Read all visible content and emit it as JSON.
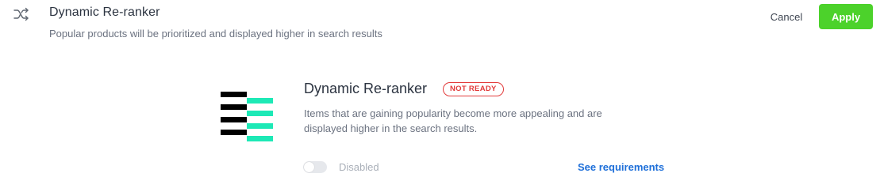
{
  "header": {
    "icon": "shuffle-icon",
    "title": "Dynamic Re-ranker",
    "subtitle": "Popular products will be prioritized and displayed higher in search results"
  },
  "actions": {
    "cancel_label": "Cancel",
    "apply_label": "Apply",
    "apply_color": "#4cd22b"
  },
  "card": {
    "illustration": "reranker-illustration",
    "title": "Dynamic Re-ranker",
    "status": "NOT READY",
    "status_color": "#e23b3b",
    "description": "Items that are gaining popularity become more appealing and are displayed higher in the search results.",
    "toggle": {
      "state": "off",
      "label": "Disabled"
    },
    "link_label": "See requirements",
    "link_color": "#1e6fd9",
    "illustration_colors": {
      "dark": "#000000",
      "accent": "#1de9b6"
    }
  }
}
